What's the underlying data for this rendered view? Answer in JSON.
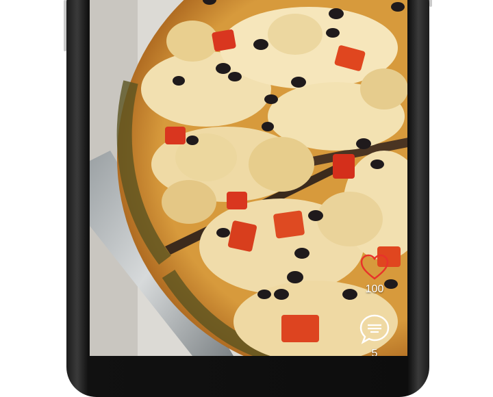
{
  "post": {
    "like_count": "100",
    "comment_count": "5"
  },
  "icons": {
    "like": "heart-outline-icon",
    "comment": "chat-bubble-icon"
  },
  "colors": {
    "like_accent": "#e8332a",
    "icon_white": "#ffffff"
  }
}
